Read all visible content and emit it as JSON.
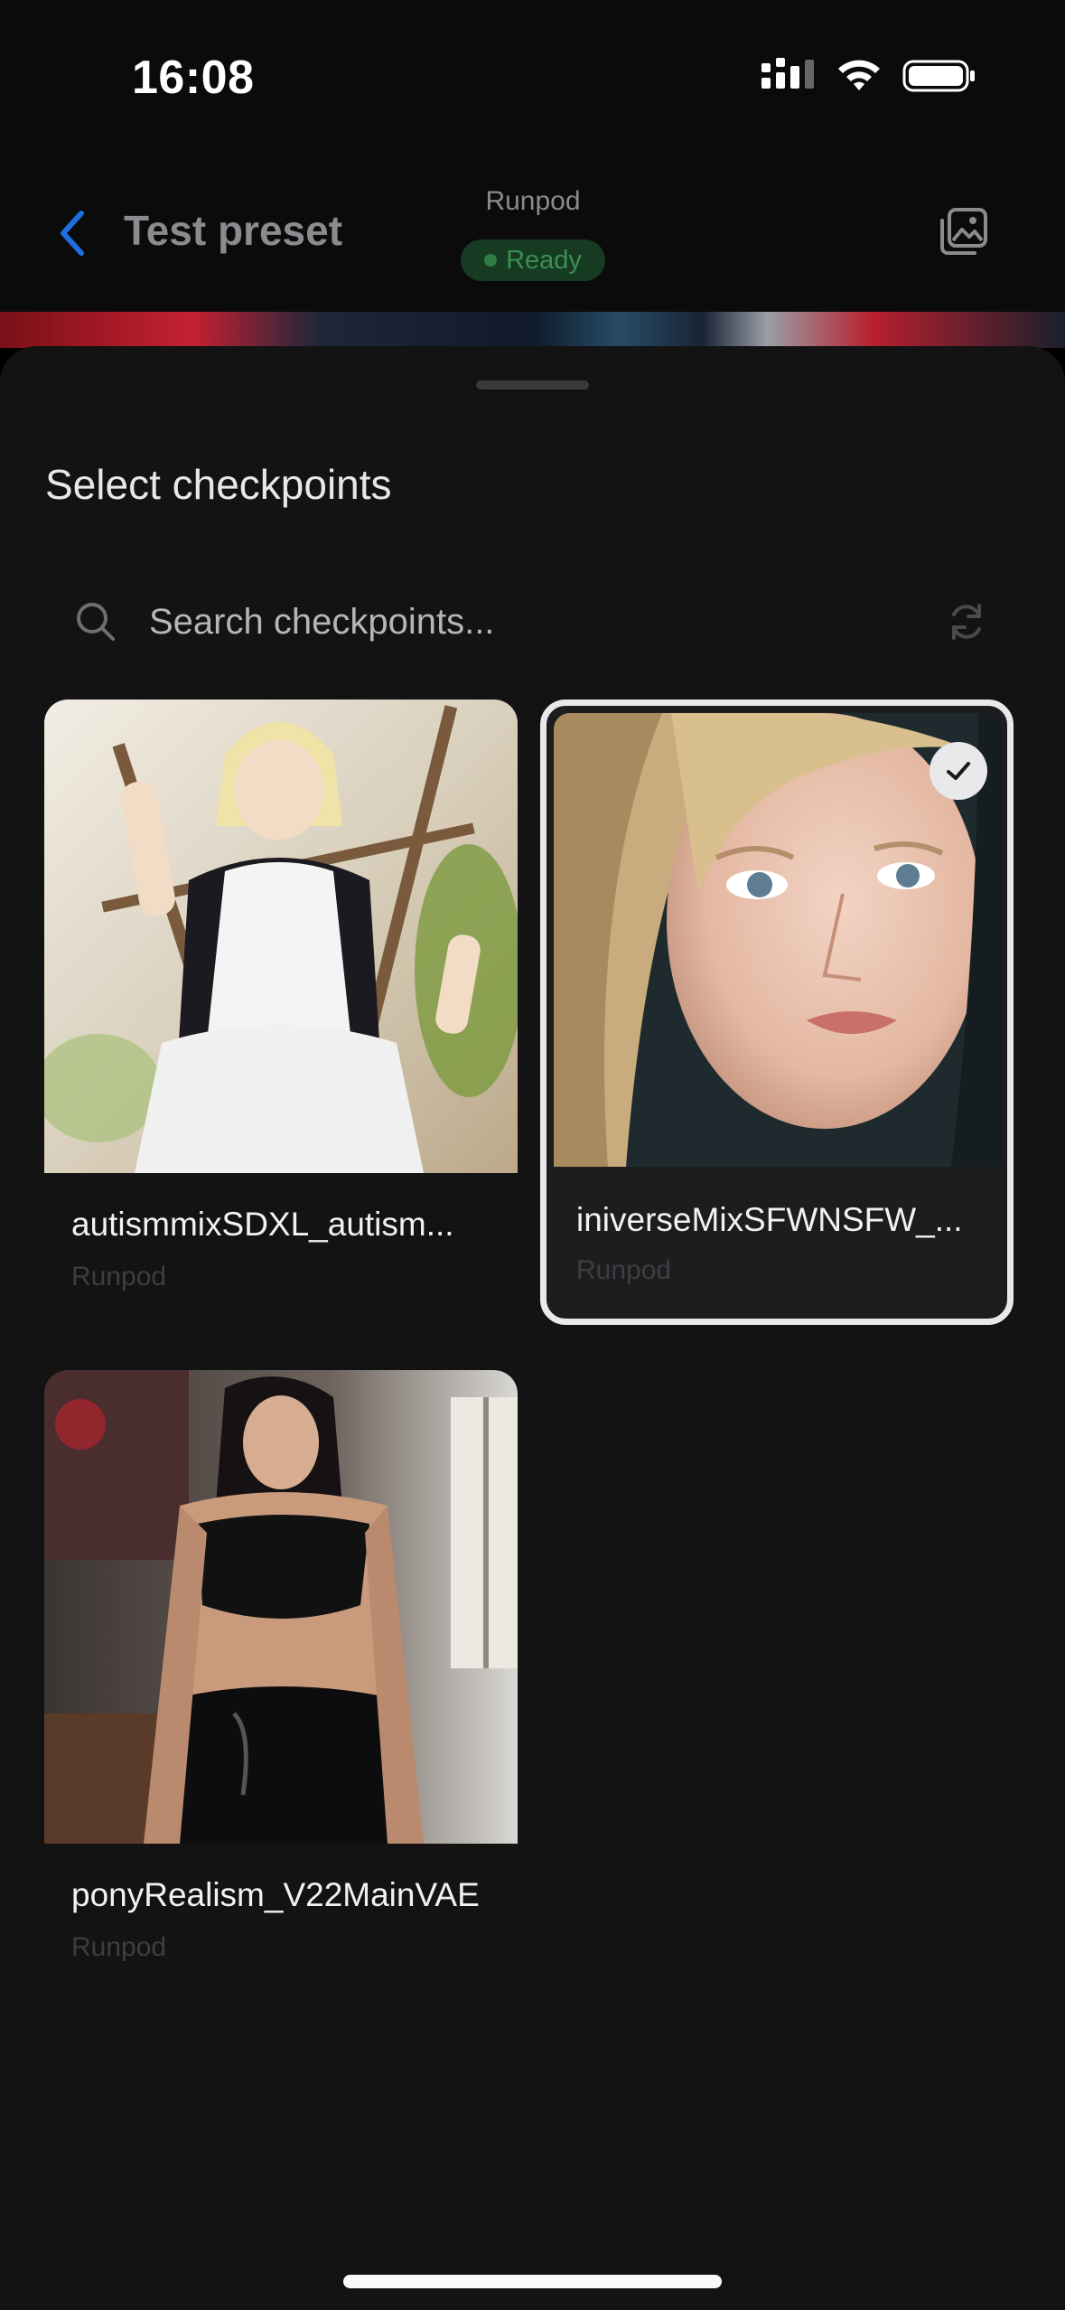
{
  "status_bar": {
    "time": "16:08"
  },
  "header": {
    "title": "Test preset",
    "provider": "Runpod",
    "status": "Ready",
    "accent": "#1f6fe0",
    "status_color": "#3b8f52"
  },
  "sheet": {
    "title": "Select checkpoints",
    "search_placeholder": "Search checkpoints..."
  },
  "checkpoints": [
    {
      "name": "autismmixSDXL_autism...",
      "provider": "Runpod",
      "selected": false,
      "thumb_icon": "anime-maid-illustration"
    },
    {
      "name": "iniverseMixSFWNSFW_...",
      "provider": "Runpod",
      "selected": true,
      "thumb_icon": "blonde-portrait-photo"
    },
    {
      "name": "ponyRealism_V22MainVAE",
      "provider": "Runpod",
      "selected": false,
      "thumb_icon": "woman-latex-outfit-photo"
    }
  ]
}
